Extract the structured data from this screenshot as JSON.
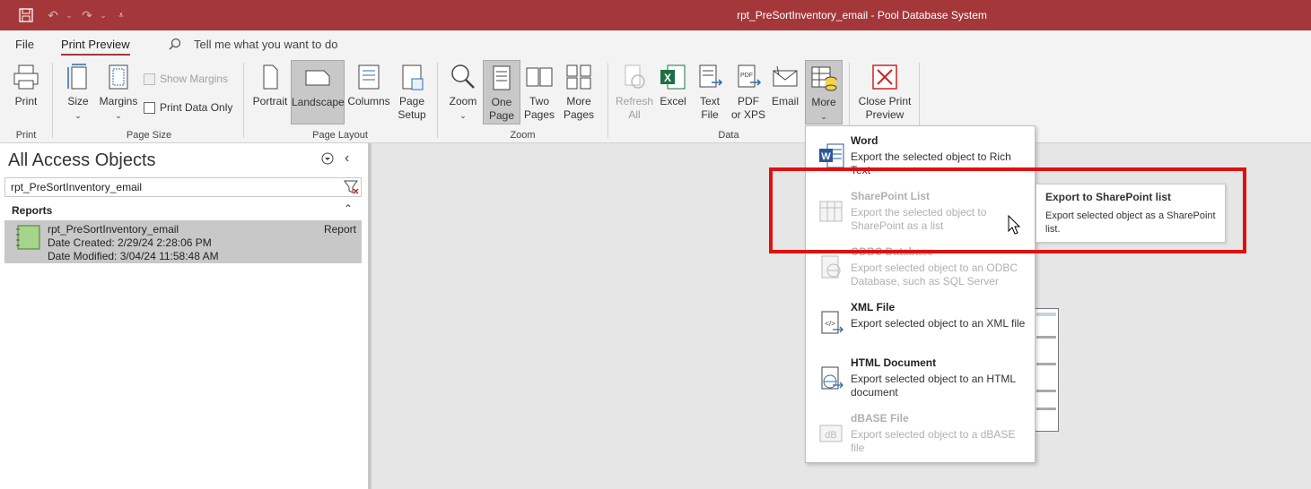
{
  "titlebar": {
    "title": "rpt_PreSortInventory_email  -  Pool Database System"
  },
  "tabs": [
    {
      "label": "File"
    },
    {
      "label": "Print Preview"
    }
  ],
  "tell_me": "Tell me what you want to do",
  "ribbon": {
    "print": {
      "label": "Print",
      "group": "Print"
    },
    "size": {
      "label": "Size"
    },
    "margins": {
      "label": "Margins"
    },
    "show_margins": {
      "label": "Show Margins"
    },
    "print_data_only": {
      "label": "Print Data Only"
    },
    "page_size_group": "Page Size",
    "portrait": {
      "label": "Portrait"
    },
    "landscape": {
      "label": "Landscape"
    },
    "columns": {
      "label": "Columns"
    },
    "page_setup": {
      "label1": "Page",
      "label2": "Setup"
    },
    "page_layout_group": "Page Layout",
    "zoom": {
      "label": "Zoom"
    },
    "one_page": {
      "label1": "One",
      "label2": "Page"
    },
    "two_pages": {
      "label1": "Two",
      "label2": "Pages"
    },
    "more_pages": {
      "label1": "More",
      "label2": "Pages"
    },
    "zoom_group": "Zoom",
    "refresh_all": {
      "label1": "Refresh",
      "label2": "All"
    },
    "excel": {
      "label": "Excel"
    },
    "text_file": {
      "label1": "Text",
      "label2": "File"
    },
    "pdf": {
      "label1": "PDF",
      "label2": "or XPS"
    },
    "email": {
      "label": "Email"
    },
    "more": {
      "label": "More"
    },
    "data_group": "Data",
    "close_preview": {
      "label1": "Close Print",
      "label2": "Preview"
    }
  },
  "nav": {
    "title": "All Access Objects",
    "search_value": "rpt_PreSortInventory_email",
    "section": "Reports",
    "item": {
      "name": "rpt_PreSortInventory_email",
      "type": "Report",
      "created": "Date Created: 2/29/24 2:28:06 PM",
      "modified": "Date Modified: 3/04/24 11:58:48 AM"
    }
  },
  "menu": {
    "items": [
      {
        "title": "Word",
        "desc": "Export the selected object to Rich Text",
        "enabled": true,
        "icon": "word-icon"
      },
      {
        "title": "SharePoint List",
        "desc": "Export the selected object to SharePoint as a list",
        "enabled": false,
        "icon": "sharepoint-list-icon"
      },
      {
        "title": "ODBC Database",
        "desc": "Export selected object to an ODBC Database, such as SQL Server",
        "enabled": false,
        "icon": "odbc-icon"
      },
      {
        "title": "XML File",
        "desc": "Export selected object to an XML file",
        "enabled": true,
        "icon": "xml-icon"
      },
      {
        "title": "HTML Document",
        "desc": "Export selected object to an HTML document",
        "enabled": true,
        "icon": "html-icon"
      },
      {
        "title": "dBASE File",
        "desc": "Export selected object to a dBASE file",
        "enabled": false,
        "icon": "dbase-icon"
      }
    ]
  },
  "tooltip": {
    "title": "Export to SharePoint list",
    "desc": "Export selected object as a SharePoint list."
  },
  "colors": {
    "accent": "#a4373a",
    "highlight": "#e01010"
  }
}
